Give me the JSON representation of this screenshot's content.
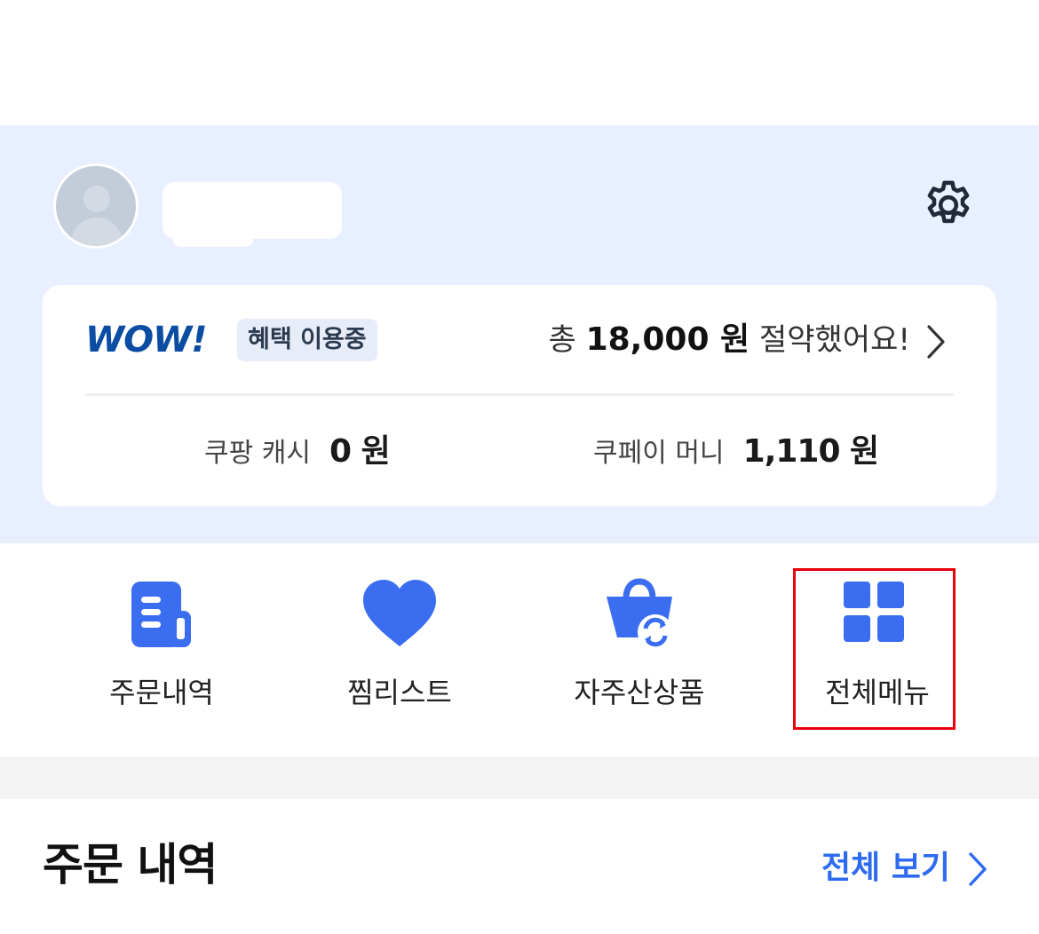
{
  "profile": {
    "avatar_icon": "default-user-avatar-icon",
    "settings_icon": "gear-icon"
  },
  "membership": {
    "logo_text": "WOW!",
    "badge": "혜택 이용중",
    "savings_prefix": "총",
    "savings_amount": "18,000 원",
    "savings_suffix": "절약했어요!"
  },
  "balances": {
    "cash_label": "쿠팡 캐시",
    "cash_value": "0 원",
    "pay_label": "쿠페이 머니",
    "pay_value": "1,110 원"
  },
  "shortcuts": [
    {
      "label": "주문내역",
      "icon": "receipt-icon"
    },
    {
      "label": "찜리스트",
      "icon": "heart-icon"
    },
    {
      "label": "자주산상품",
      "icon": "repurchase-basket-icon"
    },
    {
      "label": "전체메뉴",
      "icon": "grid-menu-icon"
    }
  ],
  "orders": {
    "title": "주문 내역",
    "view_all": "전체 보기"
  },
  "colors": {
    "accent": "#2e6bf0",
    "icon_blue": "#3a6df0",
    "profile_bg": "#e8efff",
    "wow_blue": "#0b4da2",
    "highlight": "#e8000b"
  }
}
